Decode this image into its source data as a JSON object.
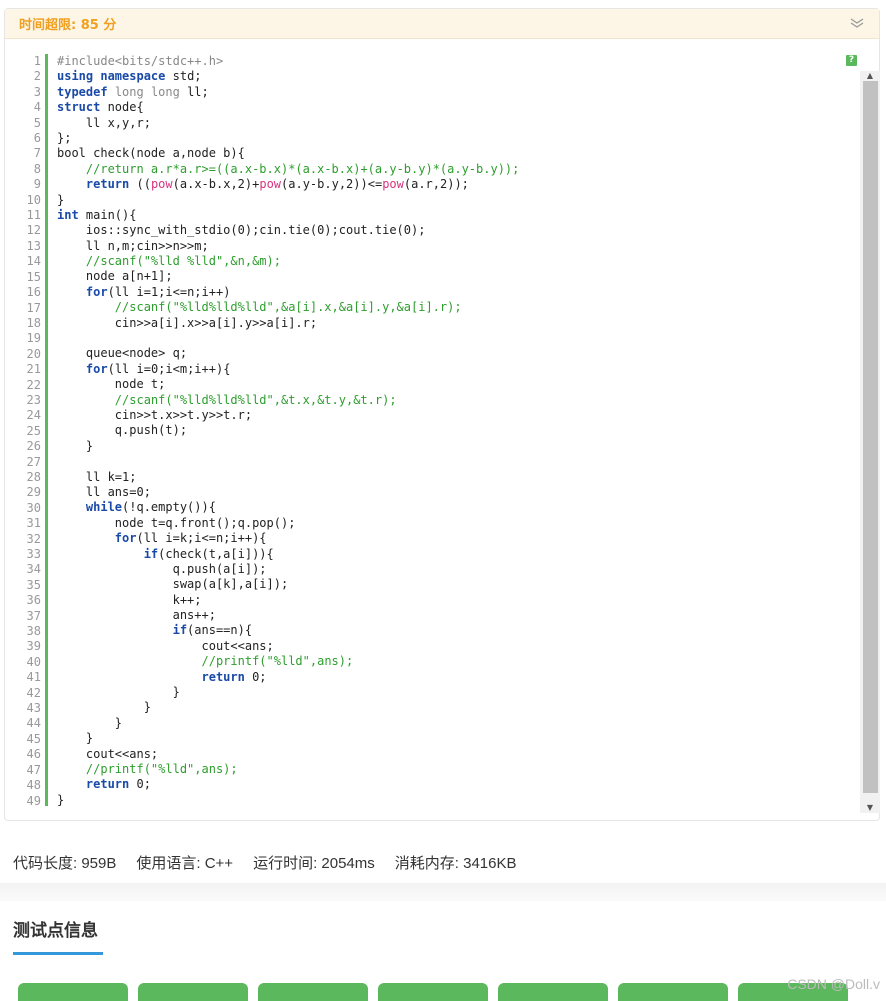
{
  "header": {
    "time_limit": "时间超限:  85 分"
  },
  "code_lines": [
    "#include<bits/stdc++.h>",
    "using namespace std;",
    "typedef long long ll;",
    "struct node{",
    "    ll x,y,r;",
    "};",
    "bool check(node a,node b){",
    "    //return a.r*a.r>=((a.x-b.x)*(a.x-b.x)+(a.y-b.y)*(a.y-b.y));",
    "    return ((pow(a.x-b.x,2)+pow(a.y-b.y,2))<=pow(a.r,2));",
    "}",
    "int main(){",
    "    ios::sync_with_stdio(0);cin.tie(0);cout.tie(0);",
    "    ll n,m;cin>>n>>m;",
    "    //scanf(\"%lld %lld\",&n,&m);",
    "    node a[n+1];",
    "    for(ll i=1;i<=n;i++)",
    "        //scanf(\"%lld%lld%lld\",&a[i].x,&a[i].y,&a[i].r);",
    "        cin>>a[i].x>>a[i].y>>a[i].r;",
    "",
    "    queue<node> q;",
    "    for(ll i=0;i<m;i++){",
    "        node t;",
    "        //scanf(\"%lld%lld%lld\",&t.x,&t.y,&t.r);",
    "        cin>>t.x>>t.y>>t.r;",
    "        q.push(t);",
    "    }",
    "",
    "    ll k=1;",
    "    ll ans=0;",
    "    while(!q.empty()){",
    "        node t=q.front();q.pop();",
    "        for(ll i=k;i<=n;i++){",
    "            if(check(t,a[i])){",
    "                q.push(a[i]);",
    "                swap(a[k],a[i]);",
    "                k++;",
    "                ans++;",
    "                if(ans==n){",
    "                    cout<<ans;",
    "                    //printf(\"%lld\",ans);",
    "                    return 0;",
    "                }",
    "            }",
    "        }",
    "    }",
    "    cout<<ans;",
    "    //printf(\"%lld\",ans);",
    "    return 0;",
    "}"
  ],
  "help_badge": "?",
  "stats": {
    "code_length": "代码长度: 959B",
    "language": "使用语言: C++",
    "run_time": "运行时间: 2054ms",
    "memory": "消耗内存: 3416KB"
  },
  "section_title": "测试点信息",
  "test_count": 7,
  "watermark": "CSDN @Doll.v",
  "colors": {
    "accent_orange": "#f0a020",
    "green": "#5cb85c",
    "tab_blue": "#3498db"
  }
}
